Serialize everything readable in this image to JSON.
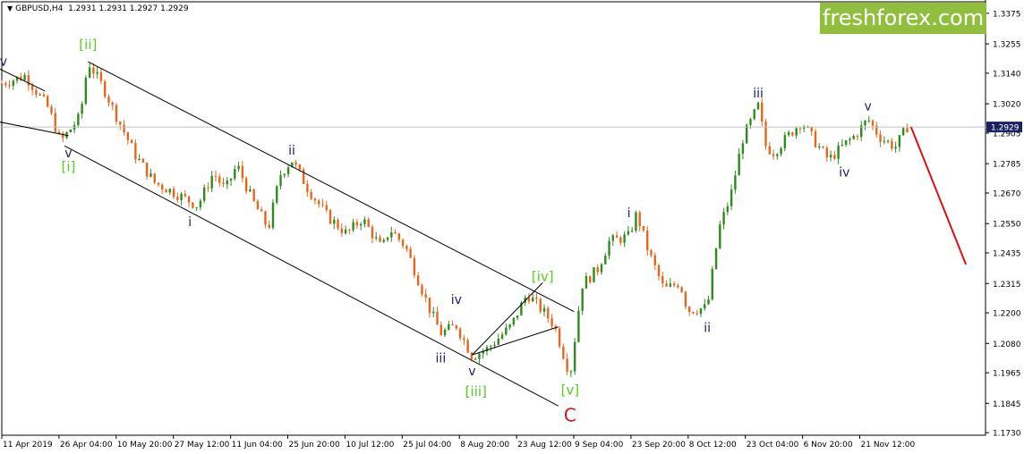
{
  "header": {
    "symbol": "GBPUSD,H4",
    "ohlc": "1.2931 1.2931 1.2927 1.2929"
  },
  "brand": {
    "text": "freshforex.com"
  },
  "colors": {
    "bull_candle": "#2e8b1e",
    "bear_candle": "#e8661b",
    "channel_lines": "#000000",
    "forecast_line": "#e01010",
    "wave_label_minor": "#1c2260",
    "wave_label_intermediate": "#55cc22",
    "wave_label_primary": "#d01818",
    "current_price_line": "#c0c0c0",
    "current_price_box": "#1c2260",
    "background": "#ffffff",
    "brand_bg": "#8fbf3c"
  },
  "chart_data": {
    "type": "candlestick",
    "symbol": "GBPUSD",
    "timeframe": "H4",
    "ylim": [
      1.172,
      1.342
    ],
    "y_ticks": [
      "1.3375",
      "1.3255",
      "1.3140",
      "1.3020",
      "1.2905",
      "1.2785",
      "1.2670",
      "1.2550",
      "1.2435",
      "1.2315",
      "1.2200",
      "1.2080",
      "1.1965",
      "1.1845",
      "1.1730"
    ],
    "x_ticks": [
      "11 Apr 2019",
      "26 Apr 04:00",
      "10 May 20:00",
      "27 May 12:00",
      "11 Jun 04:00",
      "25 Jun 20:00",
      "10 Jul 12:00",
      "25 Jul 04:00",
      "8 Aug 20:00",
      "23 Aug 12:00",
      "9 Sep 04:00",
      "23 Sep 20:00",
      "8 Oct 12:00",
      "23 Oct 04:00",
      "6 Nov 20:00",
      "21 Nov 12:00"
    ],
    "current_price": "1.2929",
    "price_path": [
      [
        "11 Apr 2019",
        1.31
      ],
      [
        "17 Apr 2019",
        1.313
      ],
      [
        "23 Apr 2019",
        1.3
      ],
      [
        "26 Apr 2019",
        1.287
      ],
      [
        "1 May 2019",
        1.297
      ],
      [
        "3 May 2019",
        1.3185
      ],
      [
        "7 May 2019",
        1.308
      ],
      [
        "10 May 2019",
        1.298
      ],
      [
        "15 May 2019",
        1.282
      ],
      [
        "20 May 2019",
        1.271
      ],
      [
        "24 May 2019",
        1.268
      ],
      [
        "31 May 2019",
        1.262
      ],
      [
        "4 Jun 2019",
        1.275
      ],
      [
        "7 Jun 2019",
        1.268
      ],
      [
        "10 Jun 2019",
        1.278
      ],
      [
        "14 Jun 2019",
        1.264
      ],
      [
        "18 Jun 2019",
        1.253
      ],
      [
        "21 Jun 2019",
        1.274
      ],
      [
        "24 Jun 2019",
        1.28
      ],
      [
        "28 Jun 2019",
        1.269
      ],
      [
        "3 Jul 2019",
        1.258
      ],
      [
        "8 Jul 2019",
        1.251
      ],
      [
        "12 Jul 2019",
        1.257
      ],
      [
        "17 Jul 2019",
        1.245
      ],
      [
        "19 Jul 2019",
        1.253
      ],
      [
        "23 Jul 2019",
        1.246
      ],
      [
        "29 Jul 2019",
        1.222
      ],
      [
        "1 Aug 2019",
        1.212
      ],
      [
        "5 Aug 2019",
        1.215
      ],
      [
        "9 Aug 2019",
        1.203
      ],
      [
        "13 Aug 2019",
        1.206
      ],
      [
        "19 Aug 2019",
        1.215
      ],
      [
        "23 Aug 2019",
        1.2275
      ],
      [
        "28 Aug 2019",
        1.219
      ],
      [
        "30 Aug 2019",
        1.215
      ],
      [
        "3 Sep 2019",
        1.1955
      ],
      [
        "6 Sep 2019",
        1.231
      ],
      [
        "10 Sep 2019",
        1.237
      ],
      [
        "13 Sep 2019",
        1.248
      ],
      [
        "18 Sep 2019",
        1.25
      ],
      [
        "20 Sep 2019",
        1.259
      ],
      [
        "23 Sep 2019",
        1.244
      ],
      [
        "27 Sep 2019",
        1.229
      ],
      [
        "1 Oct 2019",
        1.232
      ],
      [
        "3 Oct 2019",
        1.221
      ],
      [
        "8 Oct 2019",
        1.222
      ],
      [
        "11 Oct 2019",
        1.253
      ],
      [
        "14 Oct 2019",
        1.266
      ],
      [
        "17 Oct 2019",
        1.288
      ],
      [
        "21 Oct 2019",
        1.3012
      ],
      [
        "23 Oct 2019",
        1.285
      ],
      [
        "25 Oct 2019",
        1.283
      ],
      [
        "29 Oct 2019",
        1.29
      ],
      [
        "1 Nov 2019",
        1.295
      ],
      [
        "5 Nov 2019",
        1.286
      ],
      [
        "8 Nov 2019",
        1.28
      ],
      [
        "12 Nov 2019",
        1.286
      ],
      [
        "15 Nov 2019",
        1.29
      ],
      [
        "18 Nov 2019",
        1.296
      ],
      [
        "21 Nov 2019",
        1.289
      ],
      [
        "25 Nov 2019",
        1.285
      ],
      [
        "28 Nov 2019",
        1.2929
      ]
    ],
    "wave_labels": [
      {
        "text": "iv",
        "date": "11 Apr 2019",
        "value": 1.317,
        "degree": "minor"
      },
      {
        "text": "[ii]",
        "date": "3 May 2019",
        "value": 1.3235,
        "degree": "intermediate"
      },
      {
        "text": "v",
        "date": "28 Apr 2019",
        "value": 1.281,
        "degree": "minor"
      },
      {
        "text": "[i]",
        "date": "28 Apr 2019",
        "value": 1.2755,
        "degree": "intermediate"
      },
      {
        "text": "i",
        "date": "29 May 2019",
        "value": 1.254,
        "degree": "minor"
      },
      {
        "text": "ii",
        "date": "24 Jun 2019",
        "value": 1.282,
        "degree": "minor"
      },
      {
        "text": "iii",
        "date": "1 Aug 2019",
        "value": 1.2005,
        "degree": "minor"
      },
      {
        "text": "iv",
        "date": "5 Aug 2019",
        "value": 1.2235,
        "degree": "minor"
      },
      {
        "text": "v",
        "date": "9 Aug 2019",
        "value": 1.1955,
        "degree": "minor"
      },
      {
        "text": "[iii]",
        "date": "10 Aug 2019",
        "value": 1.1875,
        "degree": "intermediate"
      },
      {
        "text": "[iv]",
        "date": "27 Aug 2019",
        "value": 1.2325,
        "degree": "intermediate"
      },
      {
        "text": "[v]",
        "date": "3 Sep 2019",
        "value": 1.188,
        "degree": "intermediate"
      },
      {
        "text": "C",
        "date": "3 Sep 2019",
        "value": 1.1775,
        "degree": "primary"
      },
      {
        "text": "i",
        "date": "18 Sep 2019",
        "value": 1.2575,
        "degree": "minor"
      },
      {
        "text": "ii",
        "date": "8 Oct 2019",
        "value": 1.2125,
        "degree": "minor"
      },
      {
        "text": "iii",
        "date": "21 Oct 2019",
        "value": 1.3045,
        "degree": "minor"
      },
      {
        "text": "iv",
        "date": "12 Nov 2019",
        "value": 1.2735,
        "degree": "minor"
      },
      {
        "text": "v",
        "date": "18 Nov 2019",
        "value": 1.2995,
        "degree": "minor"
      }
    ],
    "trendlines": [
      {
        "from": [
          "3 May 2019",
          1.3185
        ],
        "to": [
          "4 Sep 2019",
          1.2205
        ],
        "kind": "channel-upper"
      },
      {
        "from": [
          "27 Apr 2019",
          1.2855
        ],
        "to": [
          "31 Aug 2019",
          1.1835
        ],
        "kind": "channel-lower"
      },
      {
        "from": [
          "10 Apr 2019",
          1.316
        ],
        "to": [
          "22 Apr 2019",
          1.307
        ],
        "kind": "wave-iv-upper"
      },
      {
        "from": [
          "10 Apr 2019",
          1.295
        ],
        "to": [
          "28 Apr 2019",
          1.2895
        ],
        "kind": "wave-iv-lower"
      },
      {
        "from": [
          "9 Aug 2019",
          1.2035
        ],
        "to": [
          "27 Aug 2019",
          1.2318
        ],
        "kind": "wedge-upper"
      },
      {
        "from": [
          "9 Aug 2019",
          1.2035
        ],
        "to": [
          "31 Aug 2019",
          1.2145
        ],
        "kind": "wedge-lower"
      }
    ],
    "forecast": {
      "from": [
        "29 Nov 2019",
        1.2929
      ],
      "to": [
        "13 Dec 2019",
        1.239
      ],
      "direction": "down"
    }
  }
}
